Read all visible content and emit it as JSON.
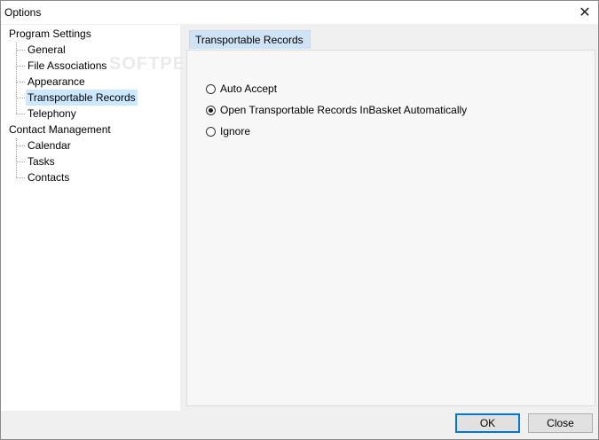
{
  "window": {
    "title": "Options"
  },
  "tree": {
    "groups": [
      {
        "label": "Program Settings",
        "children": [
          "General",
          "File Associations",
          "Appearance",
          "Transportable Records",
          "Telephony"
        ]
      },
      {
        "label": "Contact Management",
        "children": [
          "Calendar",
          "Tasks",
          "Contacts"
        ]
      }
    ],
    "selected": "Transportable Records"
  },
  "tab": {
    "label": "Transportable Records"
  },
  "options": {
    "items": [
      "Auto Accept",
      "Open Transportable Records InBasket Automatically",
      "Ignore"
    ],
    "selected": "Open Transportable Records InBasket Automatically"
  },
  "buttons": {
    "ok": "OK",
    "close": "Close"
  },
  "watermark": "SOFTPEDIA"
}
